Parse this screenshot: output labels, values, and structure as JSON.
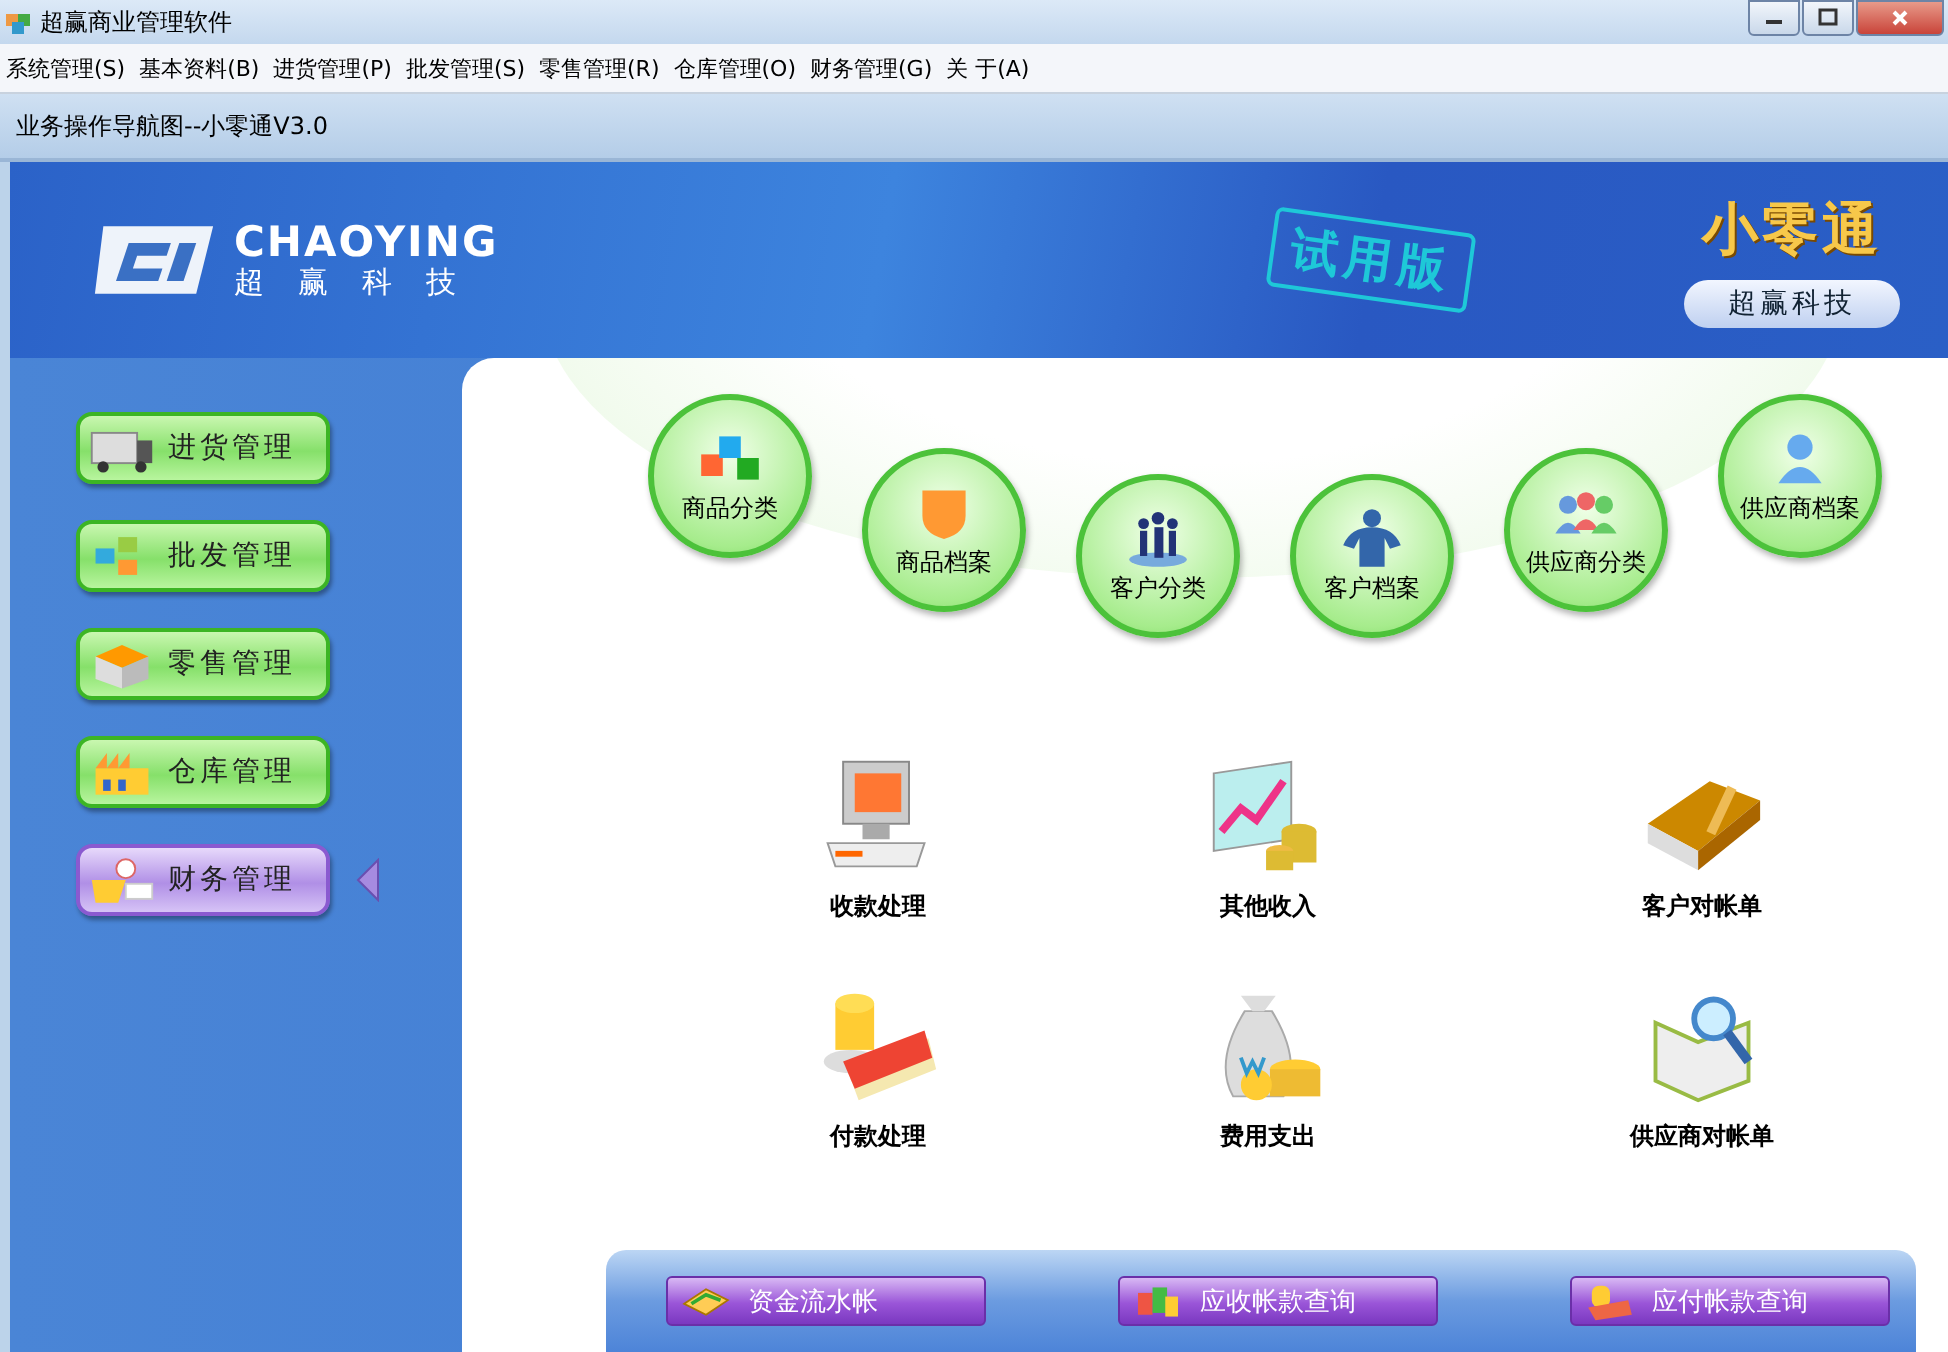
{
  "window": {
    "title": "超赢商业管理软件"
  },
  "menu": [
    "系统管理(S)",
    "基本资料(B)",
    "进货管理(P)",
    "批发管理(S)",
    "零售管理(R)",
    "仓库管理(O)",
    "财务管理(G)",
    "关 于(A)"
  ],
  "subtitle": "业务操作导航图--小零通V3.0",
  "banner": {
    "logo": "CHAOYING",
    "logo_sub": "超赢科技",
    "trial_stamp": "试用版",
    "product": "小零通",
    "company": "超赢科技"
  },
  "sidebar": [
    {
      "label": "进货管理",
      "selected": false
    },
    {
      "label": "批发管理",
      "selected": false
    },
    {
      "label": "零售管理",
      "selected": false
    },
    {
      "label": "仓库管理",
      "selected": false
    },
    {
      "label": "财务管理",
      "selected": true
    }
  ],
  "circles": [
    "商品分类",
    "商品档案",
    "客户分类",
    "客户档案",
    "供应商分类",
    "供应商档案"
  ],
  "actions": [
    "收款处理",
    "其他收入",
    "客户对帐单",
    "付款处理",
    "费用支出",
    "供应商对帐单"
  ],
  "bottom_buttons": [
    "资金流水帐",
    "应收帐款查询",
    "应付帐款查询"
  ]
}
